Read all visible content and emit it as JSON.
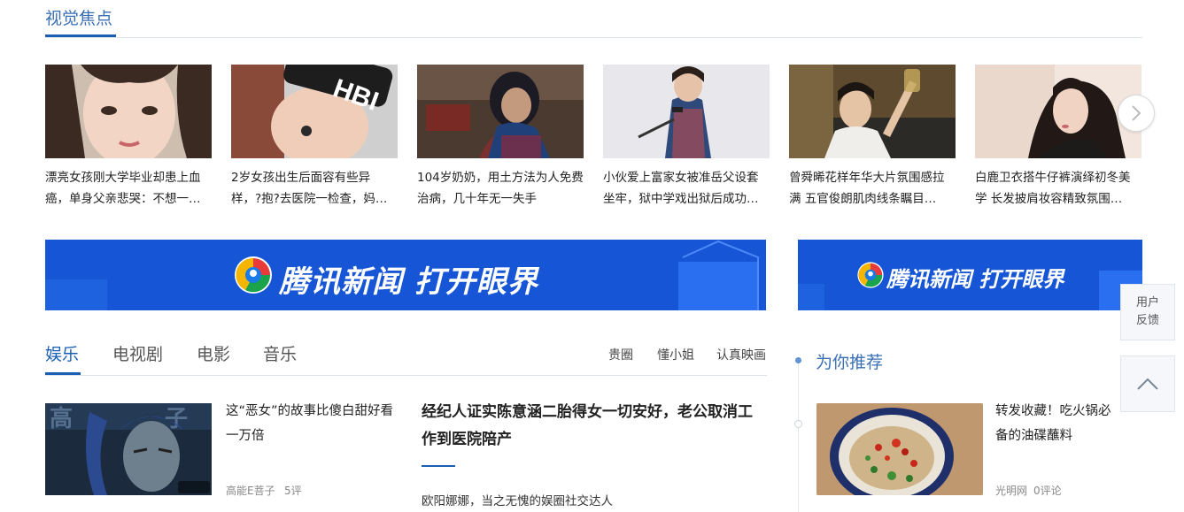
{
  "focus": {
    "title": "视觉焦点",
    "items": [
      {
        "caption": "漂亮女孩刚大学毕业却患上血癌，单身父亲悲哭：不想一…"
      },
      {
        "caption": "2岁女孩出生后面容有些异样，?抱?去医院一检查，妈…"
      },
      {
        "caption": "104岁奶奶，用土方法为人免费治病，几十年无一失手"
      },
      {
        "caption": "小伙爱上富家女被准岳父设套坐牢，狱中学戏出狱后成功…"
      },
      {
        "caption": "曾舜晞花样年华大片氛围感拉满 五官俊朗肌肉线条瞩目…"
      },
      {
        "caption": "白鹿卫衣搭牛仔裤演绎初冬美学 长发披肩妆容精致氛围…"
      }
    ]
  },
  "banner": {
    "main_text": "腾讯新闻  打开眼界",
    "side_text": "腾讯新闻  打开眼界"
  },
  "tabs": {
    "items": [
      "娱乐",
      "电视剧",
      "电影",
      "音乐"
    ],
    "sub": [
      "贵圈",
      "懂小姐",
      "认真映画"
    ]
  },
  "feed": {
    "item1": {
      "title": "这“恶女”的故事比傻白甜好看一万倍",
      "source": "高能E菩子",
      "comments": "5评"
    },
    "headline": "经纪人证实陈意涵二胎得女一切安好，老公取消工作到医院陪产",
    "sub_headline": "欧阳娜娜，当之无愧的娱圈社交达人"
  },
  "recommend": {
    "title": "为你推荐",
    "item1": {
      "title": "转发收藏！吃火锅必备的油碟蘸料",
      "source": "光明网",
      "comments": "0评论"
    }
  },
  "float": {
    "feedback": "用户反馈"
  },
  "colors": {
    "accent": "#1a5fb4",
    "banner_blue": "#1656d6"
  }
}
